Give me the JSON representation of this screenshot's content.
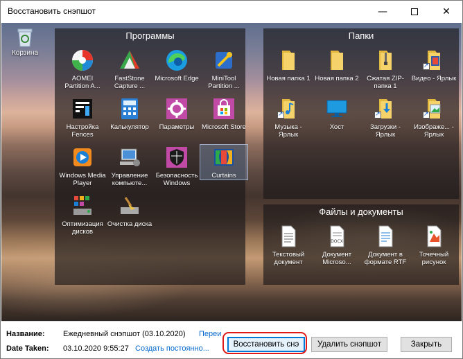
{
  "window": {
    "title": "Восстановить снэпшот"
  },
  "titlebar_icons": {
    "minimize": "minimize-icon",
    "maximize": "maximize-icon",
    "close": "close-icon"
  },
  "desktop": {
    "recycle_bin": "Корзина"
  },
  "groups": {
    "programs": {
      "title": "Программы",
      "items": [
        {
          "label": "AOMEI Partition A...",
          "icon": "aomei-icon"
        },
        {
          "label": "FastStone Capture ...",
          "icon": "faststone-icon"
        },
        {
          "label": "Microsoft Edge",
          "icon": "edge-icon"
        },
        {
          "label": "MiniTool Partition ...",
          "icon": "minitool-icon"
        },
        {
          "label": "Настройка Fences",
          "icon": "fences-icon"
        },
        {
          "label": "Калькулятор",
          "icon": "calculator-icon"
        },
        {
          "label": "Параметры",
          "icon": "settings-gear-icon"
        },
        {
          "label": "Microsoft Store",
          "icon": "store-icon"
        },
        {
          "label": "Windows Media Player",
          "icon": "media-player-icon"
        },
        {
          "label": "Управление компьюте...",
          "icon": "computer-management-icon"
        },
        {
          "label": "Безопасность Windows",
          "icon": "windows-security-icon"
        },
        {
          "label": "Curtains",
          "icon": "curtains-icon"
        },
        {
          "label": "Оптимизация дисков",
          "icon": "disk-optimize-icon"
        },
        {
          "label": "Очистка диска",
          "icon": "disk-cleanup-icon"
        }
      ]
    },
    "folders": {
      "title": "Папки",
      "items": [
        {
          "label": "Новая папка 1",
          "icon": "folder-icon"
        },
        {
          "label": "Новая папка 2",
          "icon": "folder-icon"
        },
        {
          "label": "Сжатая ZIP-папка 1",
          "icon": "zip-folder-icon"
        },
        {
          "label": "Видео - Ярлык",
          "icon": "video-folder-icon"
        },
        {
          "label": "Музыка - Ярлык",
          "icon": "music-folder-icon"
        },
        {
          "label": "Хост",
          "icon": "monitor-icon"
        },
        {
          "label": "Загрузки - Ярлык",
          "icon": "downloads-folder-icon"
        },
        {
          "label": "Изображе... - Ярлык",
          "icon": "pictures-folder-icon"
        }
      ]
    },
    "files": {
      "title": "Файлы и документы",
      "items": [
        {
          "label": "Текстовый документ",
          "icon": "text-document-icon"
        },
        {
          "label": "Документ Microso...",
          "icon": "docx-icon"
        },
        {
          "label": "Документ в формате RTF",
          "icon": "rtf-icon"
        },
        {
          "label": "Точечный рисунок",
          "icon": "bitmap-icon"
        }
      ]
    }
  },
  "details": {
    "name_label": "Название:",
    "name_value": "Ежедневный снэпшот (03.10.2020)",
    "rename_link": "Переи",
    "date_label": "Date Taken:",
    "date_value": "03.10.2020 9:55:27",
    "permanent_link": "Создать постоянно..."
  },
  "buttons": {
    "restore": "Восстановить снэ",
    "delete": "Удалить снэпшот",
    "close": "Закрыть"
  },
  "colors": {
    "highlight_ring": "#e01818",
    "link": "#0066cc",
    "accent": "#0078d7"
  }
}
